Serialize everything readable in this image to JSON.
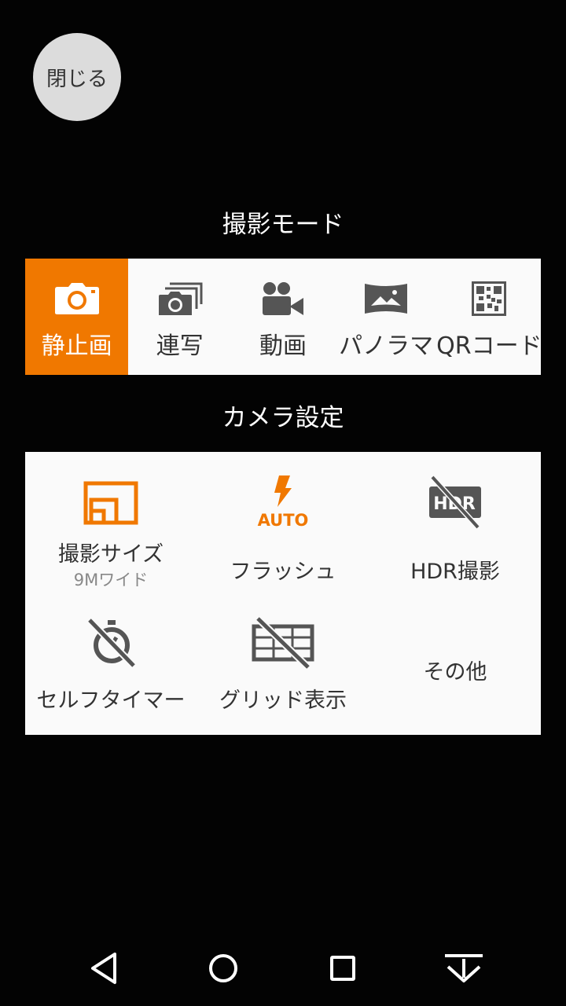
{
  "close_button": {
    "label": "閉じる"
  },
  "shooting_mode": {
    "title": "撮影モード",
    "modes": [
      {
        "label": "静止画",
        "icon": "camera-icon",
        "active": true
      },
      {
        "label": "連写",
        "icon": "burst-icon",
        "active": false
      },
      {
        "label": "動画",
        "icon": "video-camera-icon",
        "active": false
      },
      {
        "label": "パノラマ",
        "icon": "panorama-icon",
        "active": false
      },
      {
        "label": "QRコード",
        "icon": "qr-code-icon",
        "active": false
      }
    ]
  },
  "camera_settings": {
    "title": "カメラ設定",
    "items": [
      {
        "label": "撮影サイズ",
        "sub": "9Mワイド",
        "icon": "photo-size-icon"
      },
      {
        "label": "フラッシュ",
        "icon": "flash-auto-icon",
        "icon_text": "AUTO"
      },
      {
        "label": "HDR撮影",
        "icon": "hdr-off-icon",
        "icon_text": "HDR"
      },
      {
        "label": "セルフタイマー",
        "icon": "self-timer-off-icon"
      },
      {
        "label": "グリッド表示",
        "icon": "grid-off-icon"
      },
      {
        "label": "その他"
      }
    ]
  },
  "colors": {
    "accent": "#f07800",
    "panel": "#fafafa",
    "icon_gray": "#555555"
  }
}
